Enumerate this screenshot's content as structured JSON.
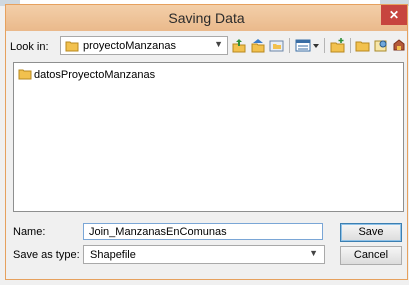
{
  "dialog": {
    "title": "Saving Data",
    "close_symbol": "✕"
  },
  "lookin": {
    "label": "Look in:",
    "value": "proyectoManzanas",
    "folder_icon": "folder-icon"
  },
  "toolbar": {
    "icons": [
      "up-one-level-icon",
      "home-icon",
      "connect-folder-icon",
      "view-details-icon",
      "new-folder-icon",
      "folder-icon",
      "catalog-icon",
      "database-icon"
    ]
  },
  "files": [
    {
      "name": "datosProyectoManzanas",
      "icon": "folder-icon"
    }
  ],
  "form": {
    "name_label": "Name:",
    "name_value": "Join_ManzanasEnComunas",
    "type_label": "Save as type:",
    "type_value": "Shapefile",
    "save_label": "Save",
    "cancel_label": "Cancel"
  },
  "colors": {
    "title_bar": "#eab98b",
    "close": "#c7453f",
    "folder": "#f2c14e"
  }
}
